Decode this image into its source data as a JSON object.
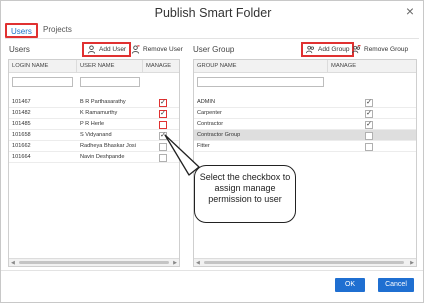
{
  "window": {
    "title": "Publish Smart Folder",
    "close_glyph": "×"
  },
  "tabs": [
    {
      "label": "Users",
      "active": true
    },
    {
      "label": "Projects",
      "active": false
    }
  ],
  "users_panel": {
    "title": "Users",
    "add_label": "Add User",
    "remove_label": "Remove User",
    "columns": [
      "LOGIN NAME",
      "USER NAME",
      "MANAGE"
    ],
    "rows": [
      {
        "login": "101467",
        "name": "B R Parthasarathy",
        "manage": true
      },
      {
        "login": "101482",
        "name": "K Ramamurthy",
        "manage": true
      },
      {
        "login": "101485",
        "name": "P R Herle",
        "manage": false
      },
      {
        "login": "101658",
        "name": "S Vidyanand",
        "manage": true
      },
      {
        "login": "101662",
        "name": "Radheya Bhaskar Josi",
        "manage": false
      },
      {
        "login": "101664",
        "name": "Navin Deshpande",
        "manage": false
      }
    ]
  },
  "groups_panel": {
    "title": "User Group",
    "add_label": "Add Group",
    "remove_label": "Remove Group",
    "columns": [
      "GROUP NAME",
      "MANAGE"
    ],
    "rows": [
      {
        "name": "ADMIN",
        "manage": true
      },
      {
        "name": "Carpenter",
        "manage": true
      },
      {
        "name": "Contractor",
        "manage": true
      },
      {
        "name": "Contractor Group",
        "manage": false
      },
      {
        "name": "Fitter",
        "manage": false
      }
    ]
  },
  "callout": {
    "text": "Select the checkbox to assign manage permission to user"
  },
  "buttons": {
    "ok": "OK",
    "cancel": "Cancel"
  },
  "colors": {
    "accent": "#1f6fd1",
    "highlight": "#e03131",
    "selected_row": "#dedede"
  },
  "icons": [
    "close-icon",
    "add-user-icon",
    "remove-user-icon",
    "add-group-icon",
    "remove-group-icon",
    "check-icon"
  ]
}
